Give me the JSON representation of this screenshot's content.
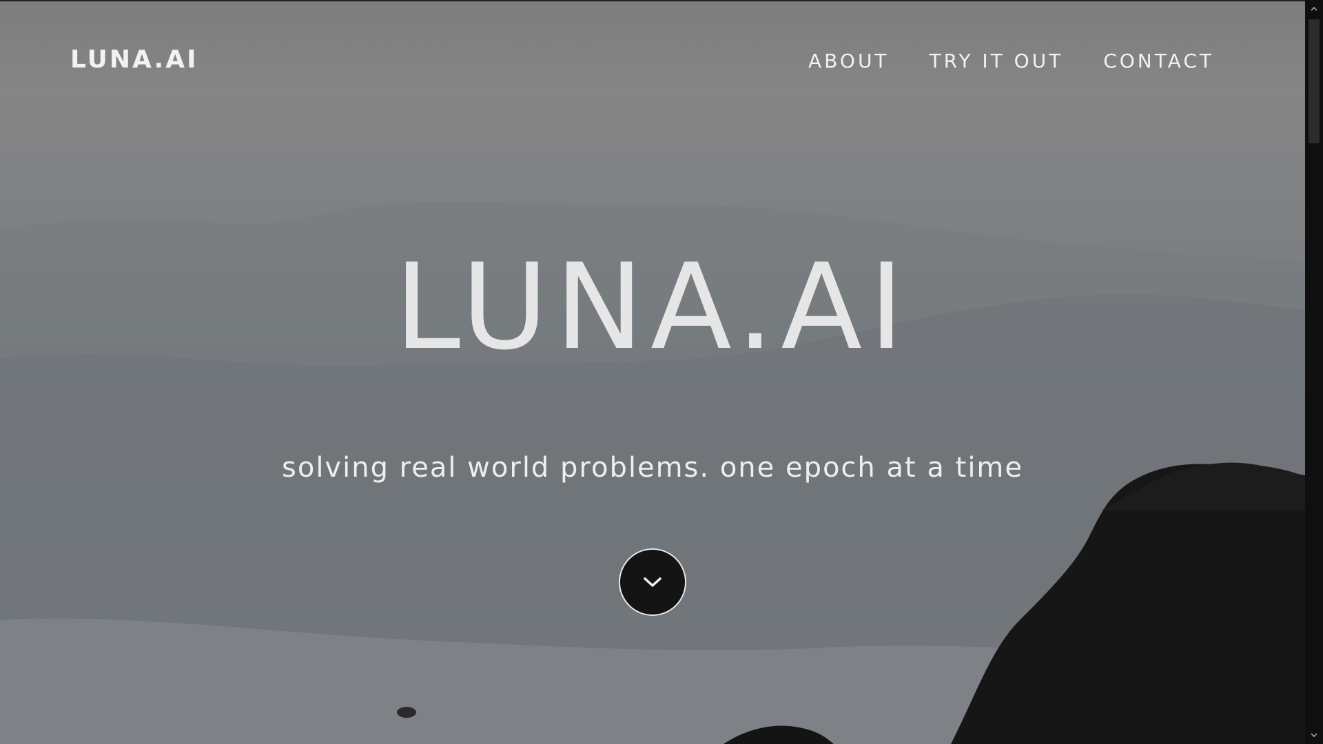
{
  "nav": {
    "brand": "LUNA.AI",
    "links": [
      "ABOUT",
      "TRY IT OUT",
      "CONTACT"
    ]
  },
  "hero": {
    "title": "LUNA.AI",
    "subtitle": "solving real world problems. one epoch at a time"
  },
  "icons": {
    "scroll_down": "chevron-down-icon",
    "scroll_up_arrow": "scrollbar-up-arrow-icon",
    "scroll_down_arrow": "scrollbar-down-arrow-icon"
  },
  "colors": {
    "text": "#f2f2f2",
    "hero_title": "#e6e6e6",
    "button_bg": "#141414",
    "scrollbar_track": "#0f0f0f",
    "scrollbar_thumb": "#2c2c2c"
  }
}
